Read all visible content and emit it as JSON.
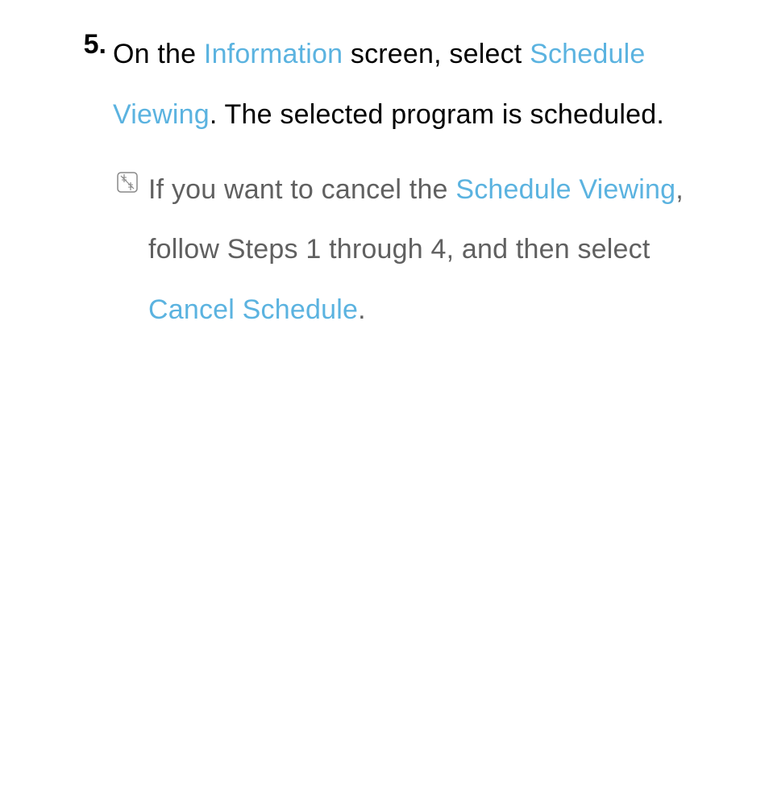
{
  "step": {
    "number": "5.",
    "text_part1": "On the ",
    "highlight1": "Information",
    "text_part2": " screen, select ",
    "highlight2": "Schedule Viewing",
    "period1": ".",
    "text_part3": " The selected program is scheduled.",
    "period2": ""
  },
  "note": {
    "text_part1": "If you want to cancel the ",
    "highlight1": "Schedule Viewing",
    "text_part2": ", follow Steps 1 through 4, and then select ",
    "highlight2": "Cancel Schedule",
    "period": "."
  }
}
